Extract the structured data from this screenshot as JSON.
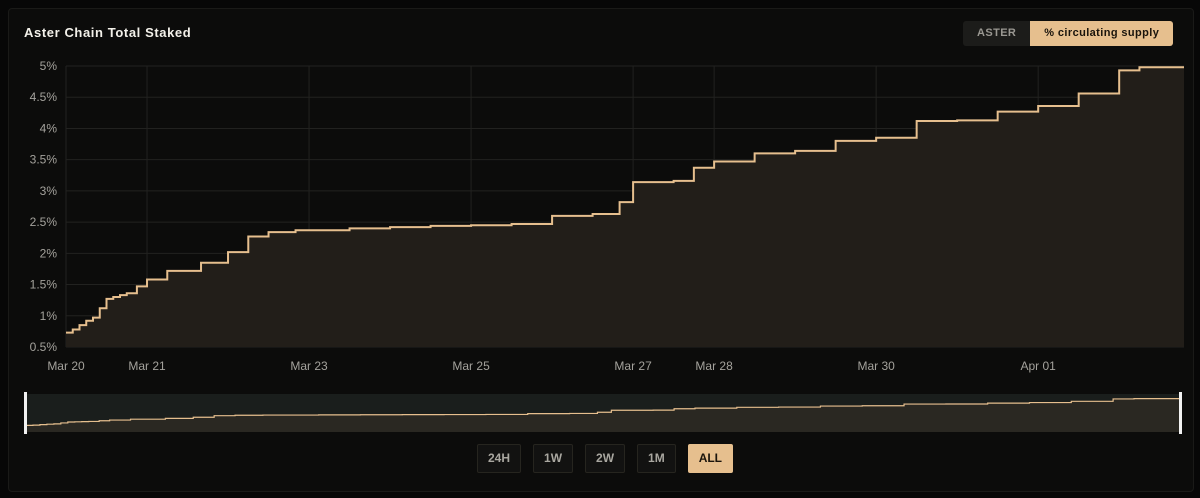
{
  "title": "Aster Chain Total Staked",
  "toggle": [
    {
      "label": "ASTER",
      "active": false
    },
    {
      "label": "% circulating supply",
      "active": true
    }
  ],
  "ranges": [
    {
      "label": "24H",
      "active": false
    },
    {
      "label": "1W",
      "active": false
    },
    {
      "label": "2W",
      "active": false
    },
    {
      "label": "1M",
      "active": false
    },
    {
      "label": "ALL",
      "active": true
    }
  ],
  "colors": {
    "line": "#e6bf8e",
    "fill": "#221e19",
    "grid": "#222220",
    "navigator_bg": "#1a1e1c"
  },
  "chart_data": {
    "type": "area",
    "title": "Aster Chain Total Staked",
    "ylabel": "% circulating supply",
    "ylim": [
      0.5,
      5
    ],
    "y_ticks": [
      "0.5%",
      "1%",
      "1.5%",
      "2%",
      "2.5%",
      "3%",
      "3.5%",
      "4%",
      "4.5%",
      "5%"
    ],
    "x_ticks": [
      "Mar 20",
      "Mar 21",
      "Mar 23",
      "Mar 25",
      "Mar 27",
      "Mar 28",
      "Mar 30",
      "Apr 01"
    ],
    "step": true,
    "grid": true,
    "legend": "none",
    "x": [
      "Mar 20 00:00",
      "Mar 20 02:00",
      "Mar 20 04:00",
      "Mar 20 06:00",
      "Mar 20 08:00",
      "Mar 20 10:00",
      "Mar 20 12:00",
      "Mar 20 14:00",
      "Mar 20 16:00",
      "Mar 20 18:00",
      "Mar 20 21:00",
      "Mar 21 00:00",
      "Mar 21 06:00",
      "Mar 21 16:00",
      "Mar 22 00:00",
      "Mar 22 06:00",
      "Mar 22 12:00",
      "Mar 22 20:00",
      "Mar 23 12:00",
      "Mar 24 00:00",
      "Mar 24 12:00",
      "Mar 25 00:00",
      "Mar 25 12:00",
      "Mar 26 00:00",
      "Mar 26 12:00",
      "Mar 26 20:00",
      "Mar 27 00:00",
      "Mar 27 12:00",
      "Mar 27 18:00",
      "Mar 28 00:00",
      "Mar 28 12:00",
      "Mar 29 00:00",
      "Mar 29 12:00",
      "Mar 30 00:00",
      "Mar 30 12:00",
      "Mar 31 00:00",
      "Mar 31 12:00",
      "Apr 01 00:00",
      "Apr 01 12:00",
      "Apr 02 00:00",
      "Apr 02 06:00"
    ],
    "values": [
      0.73,
      0.78,
      0.85,
      0.92,
      0.97,
      1.12,
      1.27,
      1.3,
      1.33,
      1.36,
      1.47,
      1.58,
      1.72,
      1.85,
      2.02,
      2.27,
      2.34,
      2.37,
      2.4,
      2.42,
      2.44,
      2.45,
      2.47,
      2.6,
      2.63,
      2.82,
      3.14,
      3.16,
      3.37,
      3.47,
      3.6,
      3.64,
      3.8,
      3.85,
      4.12,
      4.13,
      4.27,
      4.36,
      4.56,
      4.93,
      4.98
    ]
  }
}
